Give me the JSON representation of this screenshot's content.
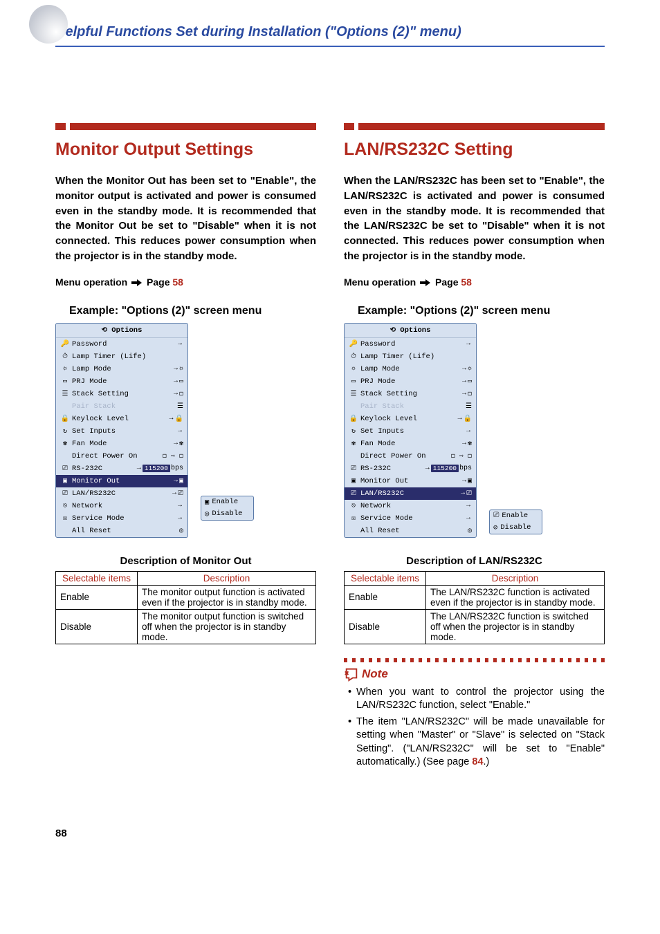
{
  "page_title": "Helpful Functions Set during Installation (\"Options (2)\" menu)",
  "page_number": "88",
  "menu_operation_label": "Menu operation",
  "menu_operation_page_label": "Page",
  "menu_operation_page_num": "58",
  "example_label": "Example: \"Options (2)\" screen menu",
  "osd": {
    "title": "Options",
    "rows": [
      {
        "icon": "🔑",
        "label": "Password",
        "arrow": "→",
        "suffix": ""
      },
      {
        "icon": "⏱",
        "label": "Lamp Timer (Life)",
        "arrow": "",
        "suffix": ""
      },
      {
        "icon": "☼",
        "label": "Lamp Mode",
        "arrow": "→",
        "suffix": "☼"
      },
      {
        "icon": "▭",
        "label": "PRJ Mode",
        "arrow": "→",
        "suffix": "▭"
      },
      {
        "icon": "☰",
        "label": "Stack Setting",
        "arrow": "→",
        "suffix": "◻"
      },
      {
        "icon": "",
        "label": "Pair Stack",
        "arrow": "",
        "suffix": "☰",
        "dimmed": true
      },
      {
        "icon": "🔒",
        "label": "Keylock Level",
        "arrow": "→",
        "suffix": "🔒"
      },
      {
        "icon": "↻",
        "label": "Set Inputs",
        "arrow": "→",
        "suffix": ""
      },
      {
        "icon": "✾",
        "label": "Fan Mode",
        "arrow": "→",
        "suffix": "✾"
      },
      {
        "icon": "",
        "label": "Direct Power On",
        "arrow": "",
        "suffix": "◻ ⇨ ◻"
      },
      {
        "icon": "⎚",
        "label": "RS-232C",
        "arrow": "→",
        "suffix": "",
        "baud": "115200",
        "baud_unit": "bps"
      },
      {
        "icon": "▣",
        "label": "Monitor Out",
        "arrow": "→",
        "suffix": "▣"
      },
      {
        "icon": "⎚",
        "label": "LAN/RS232C",
        "arrow": "→",
        "suffix": "⎚"
      },
      {
        "icon": "⎋",
        "label": "Network",
        "arrow": "→",
        "suffix": ""
      },
      {
        "icon": "☒",
        "label": "Service Mode",
        "arrow": "→",
        "suffix": ""
      },
      {
        "icon": "",
        "label": "All Reset",
        "arrow": "",
        "suffix": "◎"
      }
    ],
    "highlight_index_left": 11,
    "highlight_index_right": 12
  },
  "popup_left": [
    "Enable",
    "Disable"
  ],
  "popup_right": [
    "Enable",
    "Disable"
  ],
  "left": {
    "heading": "Monitor Output Settings",
    "intro": "When the Monitor Out has been set to \"Enable\", the monitor output is activated and power is consumed even in the standby mode. It is recommended that the Monitor Out be set to \"Disable\" when it is not connected. This reduces power consumption when the projector is in the standby mode.",
    "desc_title": "Description of Monitor Out",
    "table": {
      "headers": [
        "Selectable items",
        "Description"
      ],
      "rows": [
        [
          "Enable",
          "The monitor output function is activated even if the projector is in standby mode."
        ],
        [
          "Disable",
          "The monitor output function is switched off when the projector is in standby mode."
        ]
      ]
    }
  },
  "right": {
    "heading": "LAN/RS232C Setting",
    "intro": "When the LAN/RS232C has been set to \"Enable\", the LAN/RS232C is activated and power is consumed even in the standby mode. It is recommended that the LAN/RS232C be set to \"Disable\" when it is not connected. This reduces power consumption when the projector is in the standby mode.",
    "desc_title": "Description of LAN/RS232C",
    "table": {
      "headers": [
        "Selectable items",
        "Description"
      ],
      "rows": [
        [
          "Enable",
          "The LAN/RS232C function is activated even if the projector is in standby mode."
        ],
        [
          "Disable",
          "The LAN/RS232C function is switched off when the projector is in standby mode."
        ]
      ]
    },
    "note_label": "Note",
    "notes": [
      "When you want to control the projector using the LAN/RS232C function, select \"Enable.\"",
      "The item \"LAN/RS232C\" will be made unavailable for setting when \"Master\" or \"Slave\" is selected on \"Stack Setting\". (\"LAN/RS232C\" will be set to \"Enable\" automatically.) (See page "
    ],
    "note_pageref": "84",
    "note_suffix": ".)"
  }
}
